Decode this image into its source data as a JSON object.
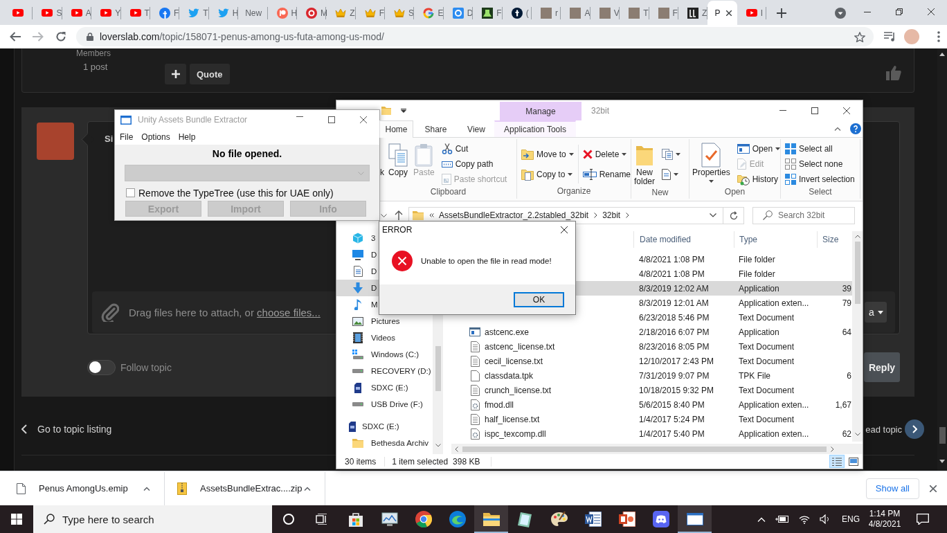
{
  "browser": {
    "tabs": [
      {
        "kind": "youtube",
        "selected": false
      },
      {
        "kind": "youtube",
        "title": "S",
        "selected": false
      },
      {
        "kind": "youtube",
        "title": "A",
        "selected": false
      },
      {
        "kind": "youtube",
        "title": "Y",
        "selected": false
      },
      {
        "kind": "youtube",
        "title": "T",
        "selected": false
      },
      {
        "kind": "facebook",
        "title": "F",
        "selected": false
      },
      {
        "kind": "twitter",
        "title": "T",
        "selected": false
      },
      {
        "kind": "twitter",
        "title": "H",
        "selected": false
      },
      {
        "kind": "text",
        "title": "New",
        "selected": false
      },
      {
        "kind": "patreon",
        "title": "H",
        "selected": false
      },
      {
        "kind": "mega",
        "title": "M",
        "selected": false
      },
      {
        "kind": "crown",
        "title": "Z",
        "selected": false
      },
      {
        "kind": "crown",
        "title": "F",
        "selected": false
      },
      {
        "kind": "crown",
        "title": "S",
        "selected": false
      },
      {
        "kind": "google",
        "title": "E",
        "selected": false
      },
      {
        "kind": "square",
        "title": "D",
        "selected": false
      },
      {
        "kind": "green",
        "title": "F",
        "selected": false
      },
      {
        "kind": "tumblr",
        "title": "(",
        "selected": false
      },
      {
        "kind": "thumbnail",
        "title": "r",
        "selected": false
      },
      {
        "kind": "thumbnail",
        "title": "A",
        "selected": false
      },
      {
        "kind": "thumbnail",
        "title": "V",
        "selected": false
      },
      {
        "kind": "thumbnail",
        "title": "T",
        "selected": false
      },
      {
        "kind": "thumbnail",
        "title": "F",
        "selected": false
      },
      {
        "kind": "ll",
        "title": "Z",
        "selected": false
      },
      {
        "kind": "text",
        "title": "P",
        "selected": true
      },
      {
        "kind": "youtube",
        "title": "I",
        "selected": false
      }
    ],
    "url_host": "loverslab.com",
    "url_path": "/topic/158071-penus-among-us-futa-among-us-mod/"
  },
  "page": {
    "member_group": "Members",
    "post_count": "1 post",
    "quote_button": "Quote",
    "editor_text": "Si",
    "attach_text": "Drag files here to attach, or ",
    "attach_link": "choose files...",
    "side_button": "a",
    "follow": {
      "label": "Follow topic",
      "on": false
    },
    "reply_button": "Reply",
    "back_link": "Go to topic listing",
    "next_link": "ead topic"
  },
  "uabe": {
    "title": "Unity Assets Bundle Extractor",
    "menu": [
      "File",
      "Options",
      "Help"
    ],
    "status": "No file opened.",
    "dropdown": {
      "disabled": true
    },
    "remove_typetree": {
      "label": "Remove the TypeTree (use this for UAE only)",
      "checked": false
    },
    "buttons": [
      {
        "label": "Export",
        "disabled": true
      },
      {
        "label": "Import",
        "disabled": true
      },
      {
        "label": "Info",
        "disabled": true
      }
    ]
  },
  "explorer": {
    "title": "32bit",
    "context_tab": "Manage",
    "tabs": [
      {
        "label": "Home",
        "selected": true
      },
      {
        "label": "Share",
        "selected": false
      },
      {
        "label": "View",
        "selected": false
      },
      {
        "label": "Application Tools",
        "selected": false
      }
    ],
    "ribbon": [
      {
        "label": "Clipboard",
        "partial": "k",
        "large": [
          {
            "label": "Copy",
            "disabled": false,
            "dropdown": false
          },
          {
            "label": "Paste",
            "disabled": true,
            "dropdown": false
          }
        ],
        "columns": [
          [
            {
              "label": "Cut",
              "disabled": false,
              "dropdown": false
            },
            {
              "label": "Copy path",
              "disabled": false,
              "dropdown": false
            },
            {
              "label": "Paste shortcut",
              "disabled": true,
              "dropdown": false
            }
          ]
        ]
      },
      {
        "label": "Organize",
        "columns": [
          [
            {
              "label": "Move to",
              "disabled": false,
              "dropdown": true
            },
            {
              "label": "Copy to",
              "disabled": false,
              "dropdown": true
            }
          ],
          [
            {
              "label": "Delete",
              "disabled": false,
              "dropdown": true
            },
            {
              "label": "Rename",
              "disabled": false,
              "dropdown": false
            }
          ]
        ]
      },
      {
        "label": "New",
        "large": [
          {
            "label": "New folder",
            "disabled": false,
            "dropdown": false
          }
        ],
        "columns": [
          [
            {
              "disabled": false,
              "dropdown": true
            },
            {
              "disabled": false,
              "dropdown": true
            }
          ]
        ]
      },
      {
        "label": "Open",
        "large": [
          {
            "label": "Properties",
            "disabled": false,
            "dropdown": true
          }
        ],
        "columns": [
          [
            {
              "label": "Open",
              "disabled": false,
              "dropdown": true
            },
            {
              "label": "Edit",
              "disabled": true,
              "dropdown": false
            },
            {
              "label": "History",
              "disabled": false,
              "dropdown": false
            }
          ]
        ]
      },
      {
        "label": "Select",
        "columns": [
          [
            {
              "label": "Select all",
              "disabled": false,
              "dropdown": false
            },
            {
              "label": "Select none",
              "disabled": false,
              "dropdown": false
            },
            {
              "label": "Invert selection",
              "disabled": false,
              "dropdown": false
            }
          ]
        ]
      }
    ],
    "address": {
      "path": [
        "AssetsBundleExtractor_2.2stabled_32bit",
        "32bit"
      ],
      "search_placeholder": "Search 32bit"
    },
    "nav": {
      "this_pc": [
        {
          "label": "3",
          "selected": false
        },
        {
          "label": "D",
          "selected": false
        },
        {
          "label": "D",
          "selected": false
        },
        {
          "label": "D",
          "selected": true
        },
        {
          "label": "M",
          "selected": false
        },
        {
          "label": "Pictures",
          "selected": false
        },
        {
          "label": "Videos",
          "selected": false
        },
        {
          "label": "Windows (C:)",
          "selected": false
        },
        {
          "label": "RECOVERY (D:)",
          "selected": false
        },
        {
          "label": "SDXC (E:)",
          "selected": false
        },
        {
          "label": "USB Drive (F:)",
          "selected": false
        }
      ],
      "drives": [
        {
          "label": "SDXC (E:)",
          "selected": false,
          "children": [
            {
              "label": "Bethesda Archiv",
              "selected": false
            }
          ]
        }
      ]
    },
    "columns": [
      "Date modified",
      "Type",
      "Size"
    ],
    "files": [
      {
        "date": "4/8/2021 1:08 PM",
        "type": "File folder",
        "selected": false
      },
      {
        "date": "4/8/2021 1:08 PM",
        "type": "File folder",
        "selected": false
      },
      {
        "date": "8/3/2019 12:02 AM",
        "type": "Application",
        "size": "39",
        "selected": true
      },
      {
        "date": "8/3/2019 12:01 AM",
        "type": "Application exten...",
        "size": "79",
        "selected": false
      },
      {
        "date": "6/23/2018 5:46 PM",
        "type": "Text Document",
        "selected": false
      },
      {
        "name": "astcenc.exe",
        "kind": "exe",
        "date": "2/18/2016 6:07 PM",
        "type": "Application",
        "size": "64",
        "selected": false
      },
      {
        "name": "astcenc_license.txt",
        "kind": "text",
        "date": "8/23/2016 8:05 PM",
        "type": "Text Document",
        "selected": false
      },
      {
        "name": "cecil_license.txt",
        "kind": "text",
        "date": "12/10/2017 2:43 PM",
        "type": "Text Document",
        "selected": false
      },
      {
        "name": "classdata.tpk",
        "kind": "blank",
        "date": "7/31/2019 9:07 PM",
        "type": "TPK File",
        "size": "6",
        "selected": false
      },
      {
        "name": "crunch_license.txt",
        "kind": "text",
        "date": "10/18/2015 9:32 PM",
        "type": "Text Document",
        "selected": false
      },
      {
        "name": "fmod.dll",
        "kind": "dll",
        "date": "5/6/2015 8:40 PM",
        "type": "Application exten...",
        "size": "1,67",
        "selected": false
      },
      {
        "name": "half_license.txt",
        "kind": "text",
        "date": "1/4/2017 5:24 PM",
        "type": "Text Document",
        "selected": false
      },
      {
        "name": "ispc_texcomp.dll",
        "kind": "dll",
        "date": "1/4/2017 5:40 PM",
        "type": "Application exten...",
        "size": "62",
        "selected": false
      }
    ],
    "status": {
      "items": "30 items",
      "selected": "1 item selected",
      "size": "398 KB"
    },
    "views": [
      {
        "selected": true
      },
      {
        "selected": false
      }
    ]
  },
  "error_dialog": {
    "title": "ERROR",
    "message": "Unable to open the file in read mode!",
    "button": "OK"
  },
  "downloads": {
    "items": [
      {
        "name": "Penus AmongUs.emip",
        "kind": "file"
      },
      {
        "name": "AssetsBundleExtrac....zip",
        "kind": "zip"
      }
    ],
    "show_all": "Show all"
  },
  "taskbar": {
    "search_placeholder": "Type here to search",
    "apps": [
      {
        "open": false
      },
      {
        "open": false
      },
      {
        "open": false
      },
      {
        "open": false
      },
      {
        "open": true
      },
      {
        "open": false
      },
      {
        "open": false
      },
      {
        "open": false
      },
      {
        "open": false
      },
      {
        "open": false
      },
      {
        "open": true
      }
    ],
    "language": "ENG",
    "time": "1:14 PM",
    "date": "4/8/2021"
  }
}
